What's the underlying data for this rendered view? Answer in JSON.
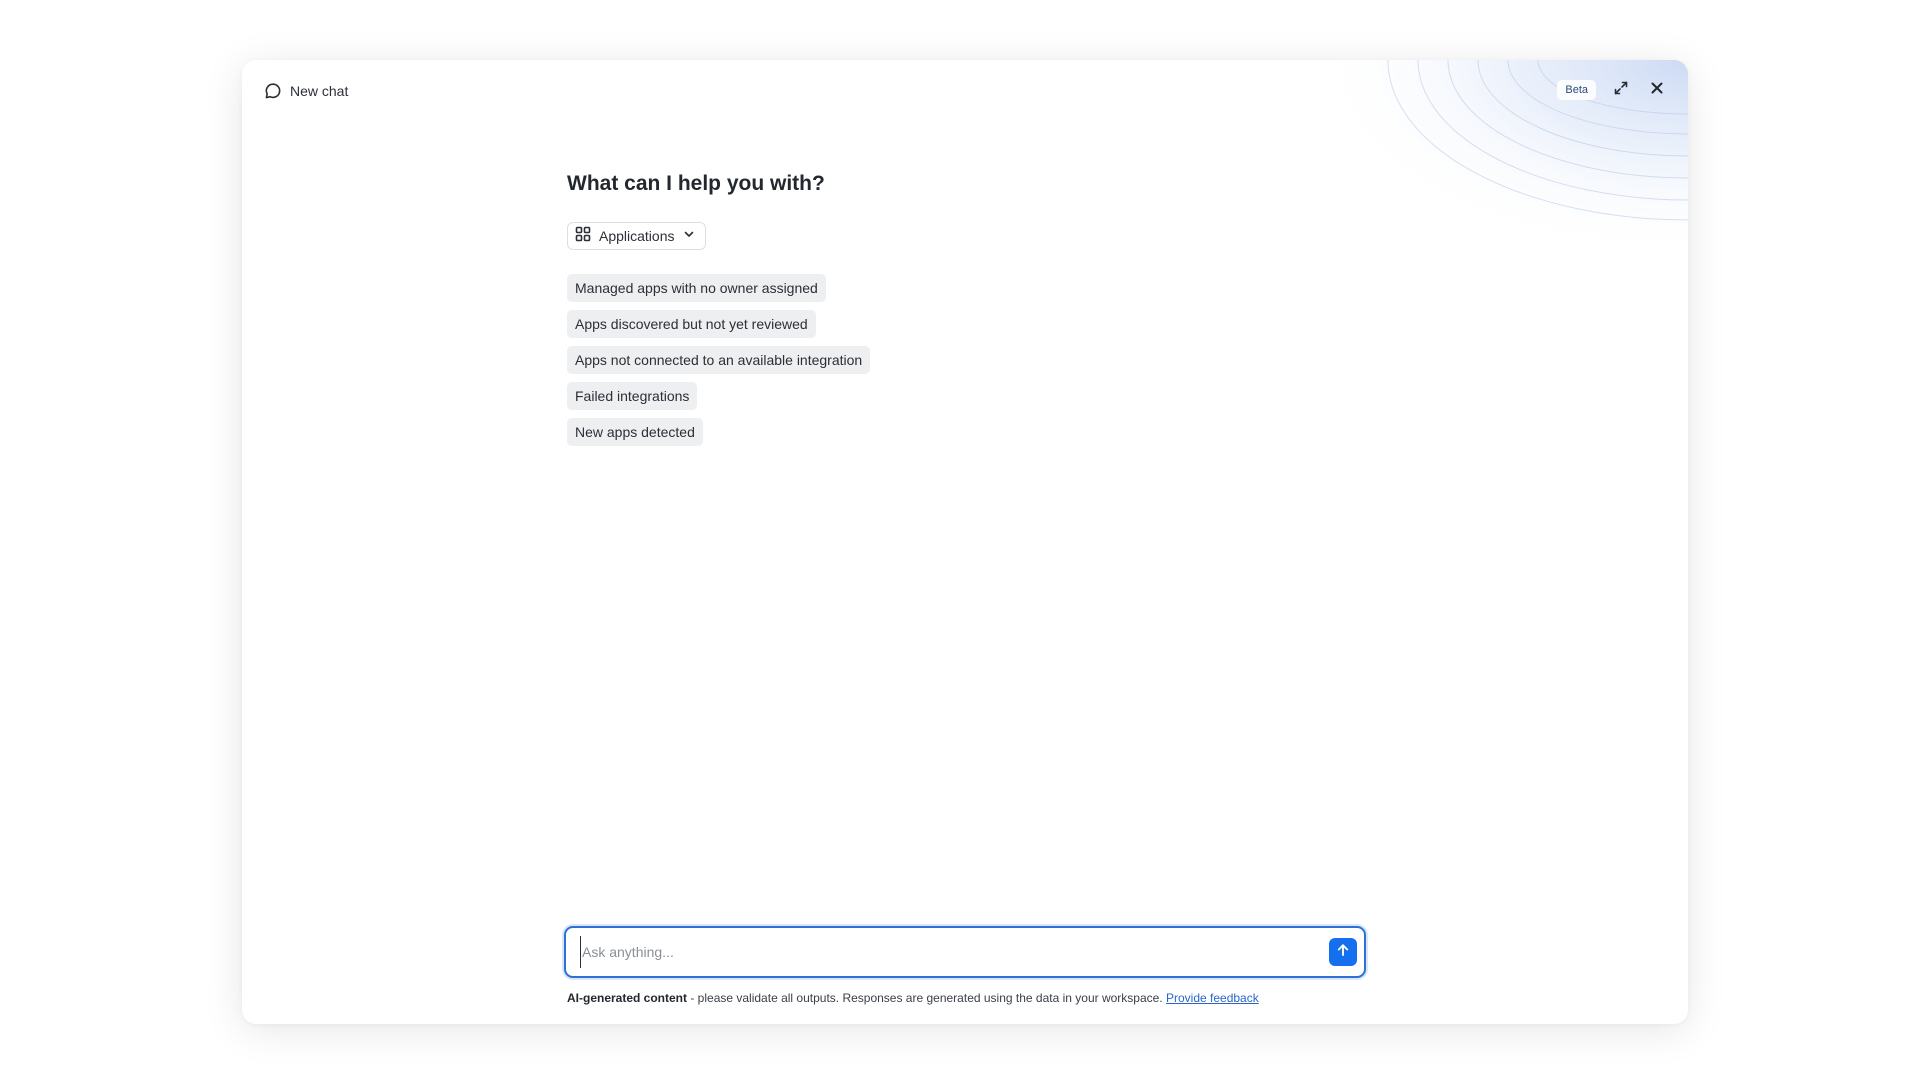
{
  "header": {
    "new_chat_label": "New chat",
    "new_chat_icon": "chat-bubble-icon",
    "beta_label": "Beta",
    "expand_icon": "expand-icon",
    "close_icon": "close-icon"
  },
  "main": {
    "heading": "What can I help you with?",
    "category_select": {
      "icon": "grid-icon",
      "selected": "Applications",
      "chevron_icon": "chevron-down-icon"
    },
    "suggestions": [
      "Managed apps with no owner assigned",
      "Apps discovered but not yet reviewed",
      "Apps not connected to an available integration",
      "Failed integrations",
      "New apps detected"
    ]
  },
  "composer": {
    "placeholder": "Ask anything...",
    "value": "",
    "send_icon": "arrow-up-icon"
  },
  "footer": {
    "disclaimer_bold": "AI-generated content",
    "disclaimer_text": " - please validate all outputs. Responses are generated using the data in your workspace. ",
    "feedback_link": "Provide feedback"
  },
  "colors": {
    "accent": "#1570ef",
    "focus_border": "#2f6fd8",
    "chip_bg": "#eeeff1",
    "link": "#2a66c9"
  }
}
